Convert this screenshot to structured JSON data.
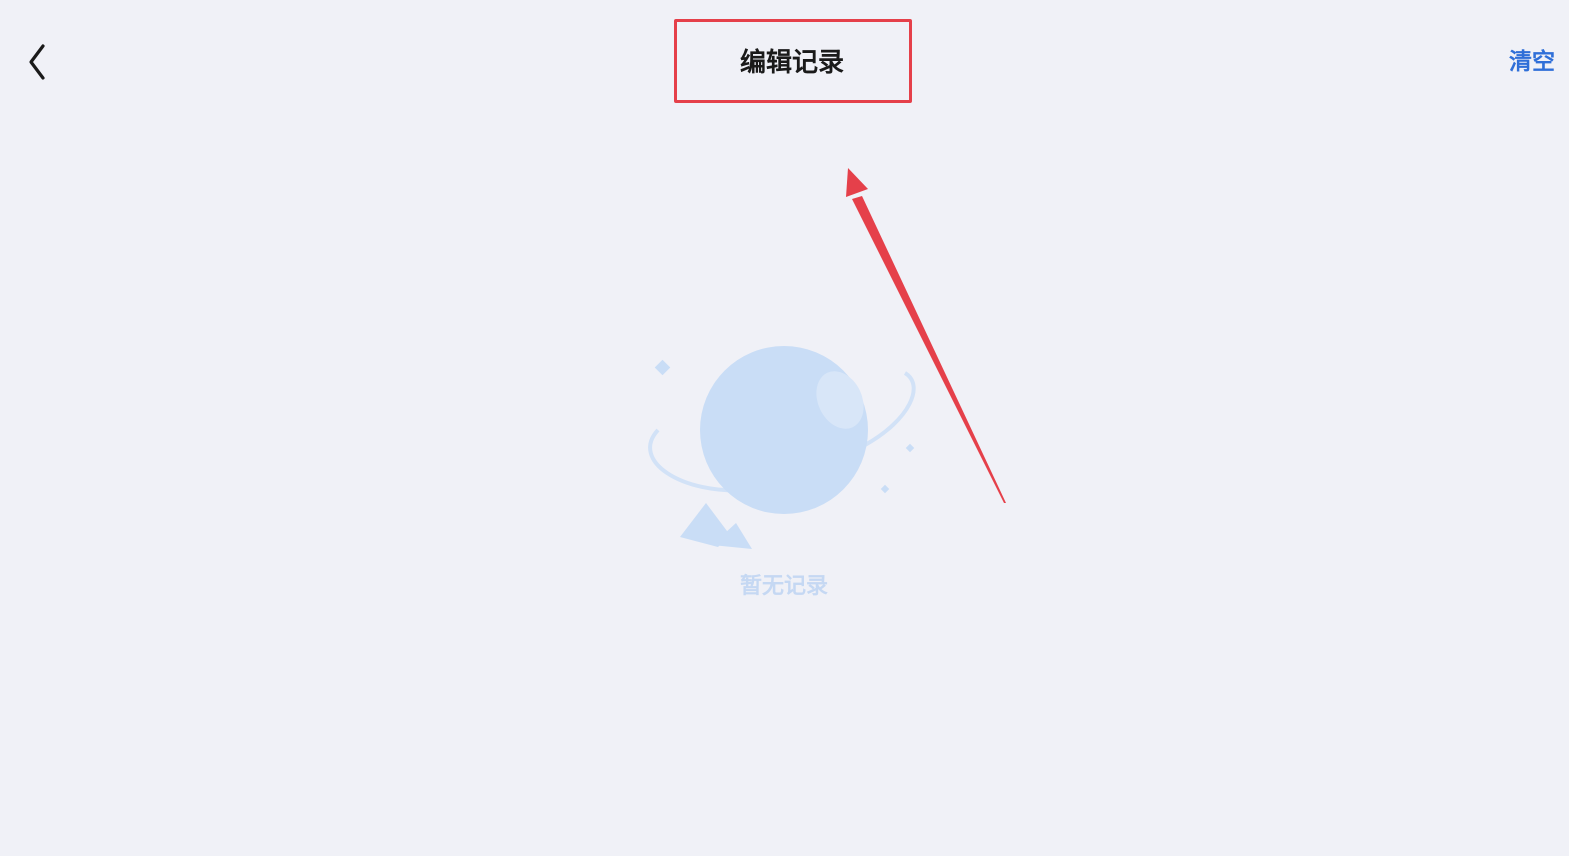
{
  "header": {
    "title": "编辑记录",
    "clear_label": "清空",
    "back_icon": "chevron-left-icon"
  },
  "empty_state": {
    "message": "暂无记录",
    "illustration_icon": "planet-icon"
  },
  "annotation": {
    "color": "#e5404a"
  },
  "colors": {
    "background": "#f0f1f7",
    "accent": "#2f6fd8",
    "illustration": "#c9ddf6"
  }
}
